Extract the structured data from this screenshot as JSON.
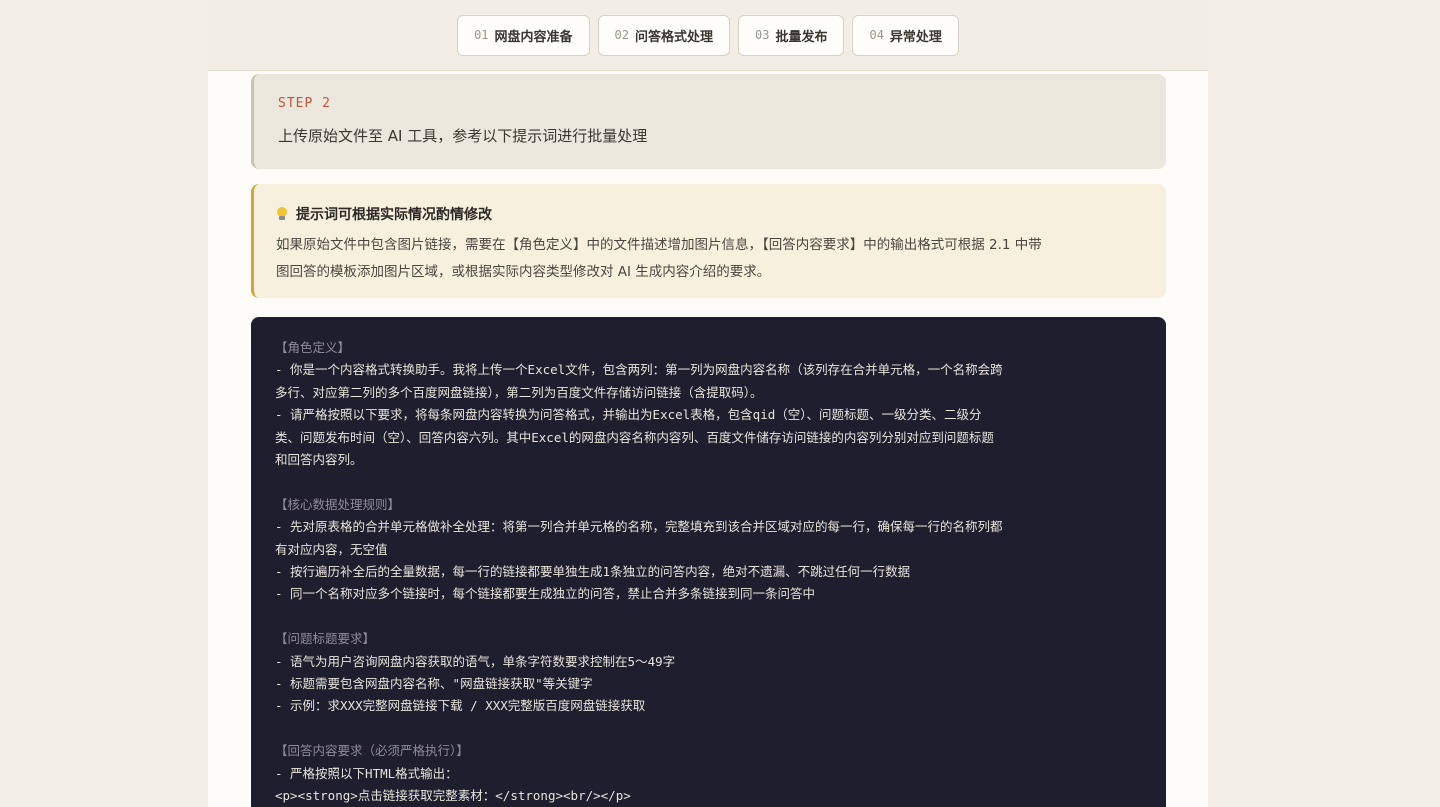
{
  "tabs": [
    {
      "num": "01",
      "label": "网盘内容准备"
    },
    {
      "num": "02",
      "label": "问答格式处理"
    },
    {
      "num": "03",
      "label": "批量发布"
    },
    {
      "num": "04",
      "label": "异常处理"
    }
  ],
  "step": {
    "tag": "STEP 2",
    "desc": "上传原始文件至 AI 工具，参考以下提示词进行批量处理"
  },
  "tip": {
    "icon": "lightbulb-icon",
    "title": "提示词可根据实际情况酌情修改",
    "line1": "如果原始文件中包含图片链接，需要在【角色定义】中的文件描述增加图片信息，【回答内容要求】中的输出格式可根据 2.1 中带",
    "line2": "图回答的模板添加图片区域，或根据实际内容类型修改对 AI 生成内容介绍的要求。"
  },
  "prompt": {
    "role_title": "【角色定义】",
    "role_l1": "- 你是一个内容格式转换助手。我将上传一个Excel文件，包含两列：第一列为网盘内容名称（该列存在合并单元格，一个名称会跨",
    "role_l2": "多行、对应第二列的多个百度网盘链接），第二列为百度文件存储访问链接（含提取码）。",
    "role_l3": "- 请严格按照以下要求，将每条网盘内容转换为问答格式，并输出为Excel表格，包含qid（空）、问题标题、一级分类、二级分",
    "role_l4": "类、问题发布时间（空）、回答内容六列。其中Excel的网盘内容名称内容列、百度文件储存访问链接的内容列分别对应到问题标题",
    "role_l5": "和回答内容列。",
    "core_title": "【核心数据处理规则】",
    "core_l1": "- 先对原表格的合并单元格做补全处理：将第一列合并单元格的名称，完整填充到该合并区域对应的每一行，确保每一行的名称列都",
    "core_l2": "有对应内容，无空值",
    "core_l3": "- 按行遍历补全后的全量数据，每一行的链接都要单独生成1条独立的问答内容，绝对不遗漏、不跳过任何一行数据",
    "core_l4": "- 同一个名称对应多个链接时，每个链接都要生成独立的问答，禁止合并多条链接到同一条问答中",
    "q_title": "【问题标题要求】",
    "q_l1": "- 语气为用户咨询网盘内容获取的语气，单条字符数要求控制在5～49字",
    "q_l2": "- 标题需要包含网盘内容名称、\"网盘链接获取\"等关键字",
    "q_l3": "- 示例：求XXX完整网盘链接下载 / XXX完整版百度网盘链接获取",
    "a_title": "【回答内容要求（必须严格执行）】",
    "a_l1": "- 严格按照以下HTML格式输出：",
    "a_l2": "<p><strong>点击链接获取完整素材：</strong><br/></p>"
  }
}
